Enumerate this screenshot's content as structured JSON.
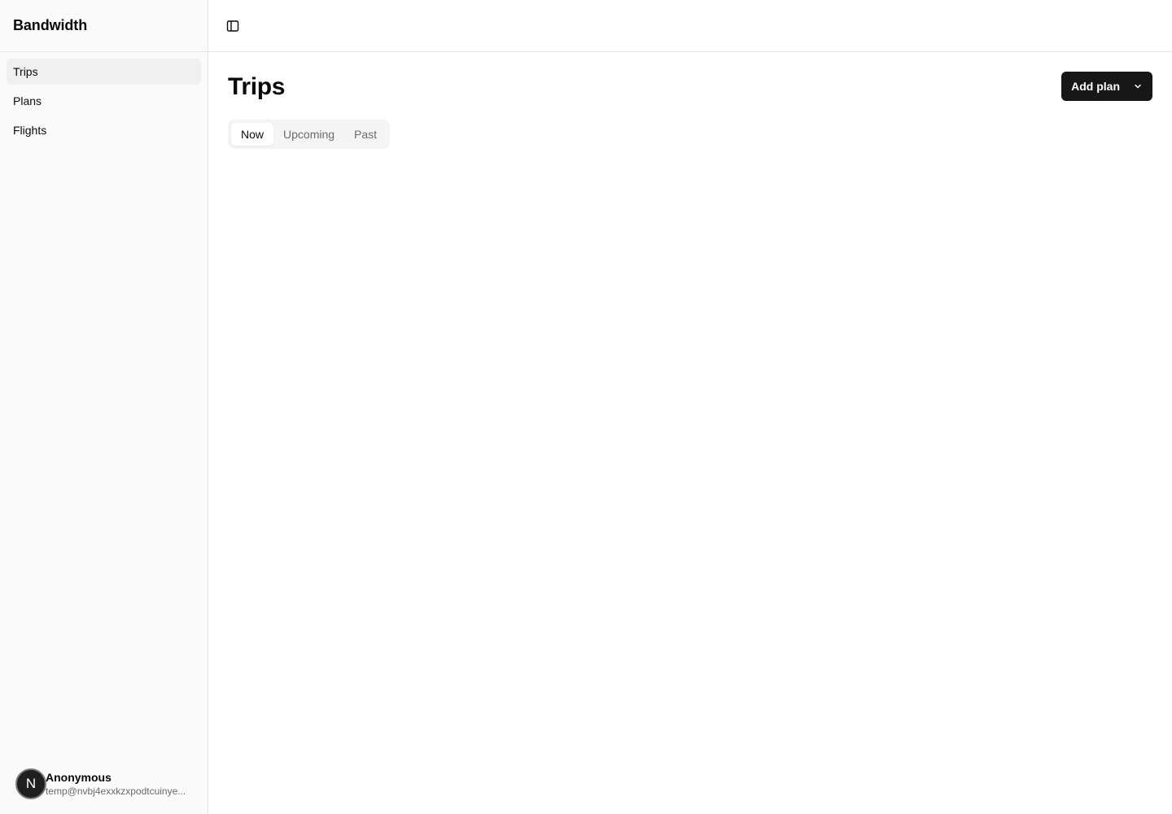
{
  "app": {
    "name": "Bandwidth"
  },
  "sidebar": {
    "items": [
      {
        "label": "Trips",
        "active": true
      },
      {
        "label": "Plans",
        "active": false
      },
      {
        "label": "Flights",
        "active": false
      }
    ],
    "user": {
      "initial": "N",
      "name": "Anonymous",
      "email": "temp@nvbj4exxkzxpodtcuinye..."
    }
  },
  "header": {
    "toggle_icon": "sidebar-toggle-icon"
  },
  "main": {
    "title": "Trips",
    "add_button": {
      "label": "Add plan",
      "icon": "chevron-down-icon"
    },
    "tabs": [
      {
        "label": "Now",
        "active": true
      },
      {
        "label": "Upcoming",
        "active": false
      },
      {
        "label": "Past",
        "active": false
      }
    ]
  },
  "colors": {
    "sidebar_bg": "#fafafa",
    "primary_button": "#171717",
    "border": "#e5e5e5"
  }
}
